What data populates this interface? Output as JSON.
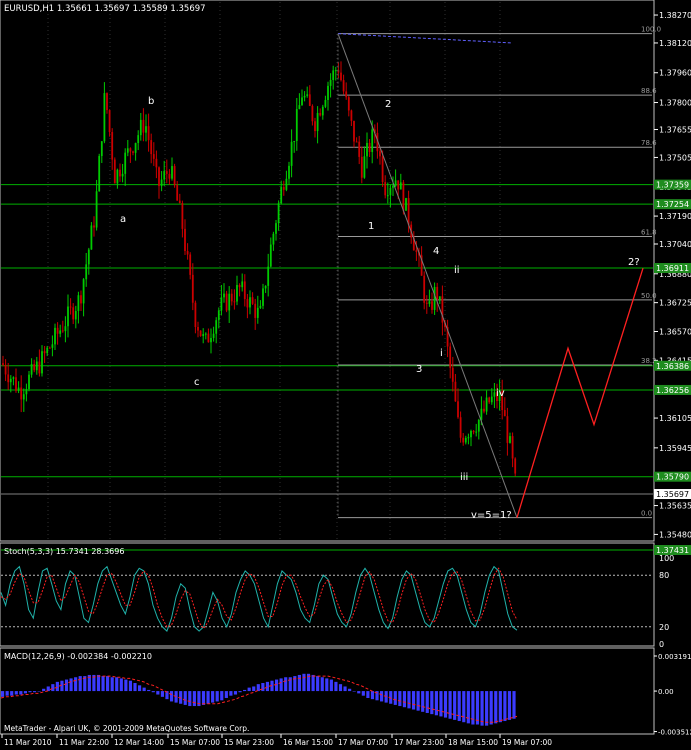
{
  "chart_header": "EURUSD,H1  1.35661 1.35697 1.35589 1.35697",
  "copyright": "MetaTrader - Alpari UK, © 2001-2009 MetaQuotes Software Corp.",
  "colors": {
    "background": "#000000",
    "up_candle": "#00cc00",
    "down_candle": "#cc0000",
    "grid": "#1f5c1f",
    "green_level": "#00b000",
    "projection": "#ff2020",
    "stoch_main": "#20b2aa",
    "stoch_signal": "#ff2020",
    "macd_hist": "#3b3bff",
    "macd_signal": "#ff2020",
    "fib": "#9a9a9a",
    "label_box": "#1e8c1e"
  },
  "chart_data": [
    {
      "type": "candlestick",
      "symbol": "EURUSD",
      "timeframe": "H1",
      "ohlc_last": {
        "open": 1.35661,
        "high": 1.35697,
        "low": 1.35589,
        "close": 1.35697
      },
      "ylim": [
        1.3545,
        1.3834
      ],
      "y_ticks": [
        "1.38270",
        "1.38120",
        "1.37960",
        "1.37800",
        "1.37655",
        "1.37505",
        "1.37345",
        "1.37190",
        "1.37040",
        "1.36880",
        "1.36725",
        "1.36570",
        "1.36415",
        "1.36255",
        "1.36105",
        "1.35945",
        "1.35790",
        "1.35635",
        "1.35480"
      ],
      "x_ticks": [
        "11 Mar 2010",
        "11 Mar 22:00",
        "12 Mar 14:00",
        "15 Mar 07:00",
        "15 Mar 23:00",
        "16 Mar 15:00",
        "17 Mar 07:00",
        "17 Mar 23:00",
        "18 Mar 15:00",
        "19 Mar 07:00"
      ],
      "current_price": "1.35697",
      "horizontal_levels": [
        {
          "price": 1.37359,
          "label": "1.37359"
        },
        {
          "price": 1.37254,
          "label": "1.37254"
        },
        {
          "price": 1.36911,
          "label": "1.36911"
        },
        {
          "price": 1.36386,
          "label": "1.36386"
        },
        {
          "price": 1.36256,
          "label": "1.36256"
        },
        {
          "price": 1.3579,
          "label": "1.35790"
        }
      ],
      "fibonacci": [
        {
          "label": "100.0",
          "price": 1.3817
        },
        {
          "label": "88.6",
          "price": 1.3784
        },
        {
          "label": "78.6",
          "price": 1.3756
        },
        {
          "label": "61.8",
          "price": 1.3708
        },
        {
          "label": "50.0",
          "price": 1.3674
        },
        {
          "label": "38.2",
          "price": 1.3639
        },
        {
          "label": "0.0",
          "price": 1.3557
        }
      ],
      "wave_labels": [
        "a",
        "b",
        "c",
        "2",
        "1",
        "4",
        "3",
        "ii",
        "i",
        "iii",
        "iv",
        "v=5=1?",
        "2?"
      ],
      "projection_path": [
        {
          "price": 1.3557
        },
        {
          "price": 1.3648
        },
        {
          "price": 1.3607
        },
        {
          "price": 1.3691
        }
      ]
    },
    {
      "type": "line",
      "title": "Stoch(5,3,3) 15.7341 28.3696",
      "ylim": [
        0,
        100
      ],
      "y_ticks": [
        "100",
        "80",
        "20",
        "0"
      ],
      "levels": [
        80,
        20
      ],
      "top_label": "1.37431",
      "series": [
        {
          "name": "Stoch main",
          "values": [
            60,
            45,
            70,
            85,
            90,
            70,
            40,
            30,
            60,
            85,
            88,
            70,
            50,
            40,
            70,
            85,
            80,
            55,
            30,
            25,
            45,
            70,
            85,
            90,
            75,
            60,
            45,
            35,
            55,
            80,
            88,
            85,
            70,
            45,
            30,
            20,
            15,
            30,
            55,
            70,
            65,
            40,
            20,
            15,
            20,
            40,
            60,
            50,
            30,
            20,
            35,
            60,
            75,
            85,
            80,
            70,
            50,
            30,
            20,
            45,
            70,
            85,
            80,
            75,
            60,
            40,
            30,
            25,
            45,
            70,
            80,
            75,
            55,
            35,
            25,
            20,
            35,
            60,
            80,
            88,
            80,
            60,
            40,
            25,
            18,
            30,
            55,
            75,
            85,
            80,
            60,
            40,
            25,
            20,
            30,
            50,
            70,
            85,
            88,
            80,
            60,
            40,
            25,
            20,
            35,
            60,
            80,
            90,
            85,
            60,
            35,
            20,
            16
          ]
        },
        {
          "name": "Stoch signal",
          "values": [
            55,
            52,
            58,
            72,
            82,
            78,
            62,
            48,
            48,
            62,
            78,
            80,
            65,
            50,
            55,
            68,
            80,
            72,
            55,
            38,
            35,
            48,
            65,
            80,
            82,
            72,
            58,
            45,
            45,
            60,
            78,
            85,
            80,
            65,
            45,
            30,
            20,
            22,
            35,
            52,
            62,
            58,
            42,
            25,
            18,
            26,
            40,
            52,
            45,
            32,
            28,
            42,
            60,
            75,
            82,
            78,
            65,
            48,
            32,
            32,
            48,
            68,
            80,
            80,
            70,
            55,
            42,
            32,
            35,
            52,
            68,
            75,
            65,
            48,
            35,
            25,
            28,
            42,
            60,
            78,
            84,
            75,
            58,
            40,
            27,
            25,
            38,
            58,
            75,
            82,
            75,
            58,
            40,
            28,
            25,
            36,
            52,
            70,
            82,
            84,
            74,
            56,
            38,
            27,
            28,
            42,
            62,
            80,
            88,
            78,
            58,
            38,
            28
          ]
        }
      ]
    },
    {
      "type": "bar",
      "title": "MACD(12,26,9) -0.002384 -0.002210",
      "ylim": [
        -0.00355,
        0.00339
      ],
      "y_ticks": [
        "0.003191",
        "0.00",
        "-0.003512"
      ],
      "series": [
        {
          "name": "MACD histogram",
          "values": [
            -0.0005,
            -0.0004,
            -0.0004,
            -0.0003,
            -0.0003,
            -0.0002,
            -0.0001,
            -0.0001,
            0.0,
            0.0002,
            0.0004,
            0.0006,
            0.0008,
            0.0009,
            0.001,
            0.0011,
            0.0012,
            0.0013,
            0.0013,
            0.0014,
            0.0014,
            0.0014,
            0.0013,
            0.0013,
            0.0012,
            0.0012,
            0.0011,
            0.001,
            0.0009,
            0.0007,
            0.0005,
            0.0003,
            0.0001,
            -0.0001,
            -0.0003,
            -0.0005,
            -0.0007,
            -0.0009,
            -0.001,
            -0.0011,
            -0.0012,
            -0.0013,
            -0.0013,
            -0.0013,
            -0.0012,
            -0.0011,
            -0.001,
            -0.0009,
            -0.0008,
            -0.0006,
            -0.0004,
            -0.0003,
            -0.0001,
            0.0001,
            0.0003,
            0.0004,
            0.0006,
            0.0007,
            0.0008,
            0.0009,
            0.001,
            0.0011,
            0.0012,
            0.0012,
            0.0013,
            0.0014,
            0.0015,
            0.0015,
            0.0014,
            0.0013,
            0.0012,
            0.0011,
            0.001,
            0.0008,
            0.0006,
            0.0004,
            0.0002,
            0.0,
            -0.0002,
            -0.0004,
            -0.0006,
            -0.0007,
            -0.0008,
            -0.0009,
            -0.001,
            -0.0011,
            -0.0012,
            -0.0013,
            -0.0014,
            -0.0015,
            -0.0016,
            -0.0017,
            -0.0018,
            -0.0019,
            -0.002,
            -0.0021,
            -0.0022,
            -0.0023,
            -0.0024,
            -0.0025,
            -0.0026,
            -0.0027,
            -0.0028,
            -0.0029,
            -0.0029,
            -0.003,
            -0.003,
            -0.0029,
            -0.0028,
            -0.0027,
            -0.0026,
            -0.0025,
            -0.0024
          ]
        },
        {
          "name": "MACD signal",
          "values": [
            -0.0006,
            -0.0005,
            -0.0005,
            -0.0004,
            -0.0004,
            -0.0003,
            -0.0003,
            -0.0002,
            -0.0002,
            -0.0001,
            0.0,
            0.0002,
            0.0003,
            0.0005,
            0.0006,
            0.0008,
            0.0009,
            0.001,
            0.0011,
            0.0012,
            0.0012,
            0.0013,
            0.0013,
            0.0013,
            0.0013,
            0.0012,
            0.0012,
            0.0011,
            0.0011,
            0.001,
            0.0009,
            0.0008,
            0.0006,
            0.0005,
            0.0003,
            0.0001,
            -0.0001,
            -0.0003,
            -0.0005,
            -0.0006,
            -0.0008,
            -0.0009,
            -0.001,
            -0.0011,
            -0.0011,
            -0.0011,
            -0.0011,
            -0.0011,
            -0.001,
            -0.0009,
            -0.0008,
            -0.0007,
            -0.0005,
            -0.0004,
            -0.0002,
            -0.0001,
            0.0001,
            0.0002,
            0.0004,
            0.0005,
            0.0006,
            0.0008,
            0.0009,
            0.001,
            0.0011,
            0.0011,
            0.0012,
            0.0013,
            0.0013,
            0.0013,
            0.0013,
            0.0013,
            0.0012,
            0.0011,
            0.001,
            0.0009,
            0.0008,
            0.0006,
            0.0005,
            0.0003,
            0.0001,
            -0.0001,
            -0.0002,
            -0.0004,
            -0.0005,
            -0.0007,
            -0.0008,
            -0.0009,
            -0.001,
            -0.0011,
            -0.0012,
            -0.0013,
            -0.0014,
            -0.0015,
            -0.0016,
            -0.0017,
            -0.0018,
            -0.0019,
            -0.002,
            -0.0021,
            -0.0022,
            -0.0023,
            -0.0024,
            -0.0025,
            -0.0026,
            -0.0027,
            -0.0027,
            -0.0027,
            -0.0026,
            -0.0025,
            -0.0024,
            -0.0023,
            -0.0022
          ]
        }
      ]
    }
  ]
}
